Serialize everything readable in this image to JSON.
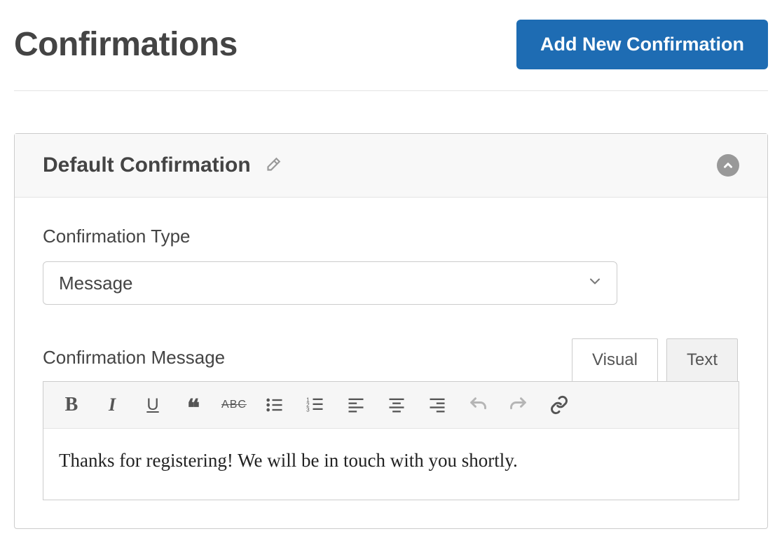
{
  "header": {
    "title": "Confirmations",
    "add_button_label": "Add New Confirmation"
  },
  "panel": {
    "title": "Default Confirmation",
    "fields": {
      "type_label": "Confirmation Type",
      "type_value": "Message",
      "message_label": "Confirmation Message"
    },
    "editor": {
      "tabs": {
        "visual": "Visual",
        "text": "Text",
        "active": "visual"
      },
      "content": "Thanks for registering! We will be in touch with you shortly."
    }
  }
}
